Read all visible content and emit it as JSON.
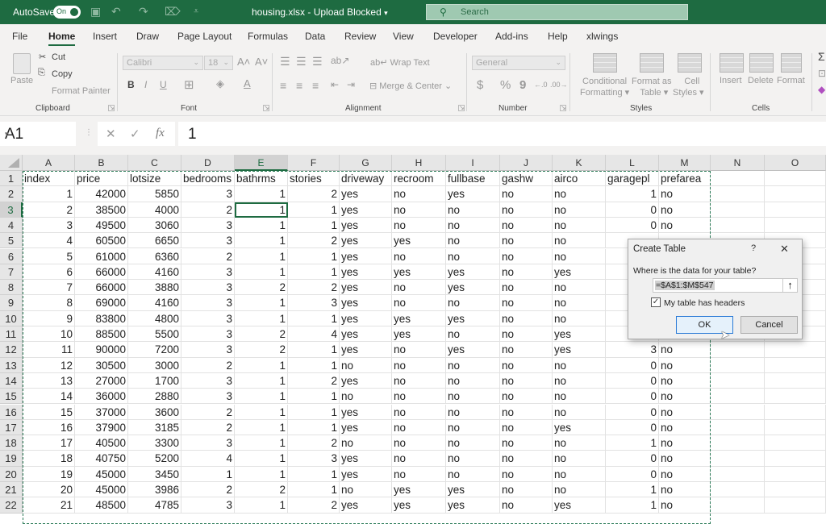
{
  "titlebar": {
    "autosave_label": "AutoSave",
    "autosave_state": "On",
    "document_title": "housing.xlsx  -  Upload Blocked",
    "title_dropdown": "▾",
    "search_placeholder": "Search",
    "qat_icons": [
      "save-icon",
      "undo-icon",
      "redo-icon",
      "format-icon",
      "customize-qat-icon"
    ]
  },
  "menu": {
    "tabs": [
      "File",
      "Home",
      "Insert",
      "Draw",
      "Page Layout",
      "Formulas",
      "Data",
      "Review",
      "View",
      "Developer",
      "Add-ins",
      "Help",
      "xlwings"
    ],
    "active": "Home"
  },
  "ribbon": {
    "clipboard": {
      "label": "Clipboard",
      "paste": "Paste",
      "cut": "Cut",
      "copy": "Copy",
      "format_painter": "Format Painter"
    },
    "font": {
      "label": "Font",
      "font_name": "Calibri",
      "font_size": "18",
      "bold": "B",
      "italic": "I",
      "underline": "U"
    },
    "alignment": {
      "label": "Alignment",
      "wrap_text": "Wrap Text",
      "merge_center": "Merge & Center"
    },
    "number": {
      "label": "Number",
      "format": "General",
      "currency": "$",
      "percent": "%",
      "comma": "9"
    },
    "styles": {
      "label": "Styles",
      "conditional": [
        "Conditional",
        "Formatting ▾"
      ],
      "format_table": [
        "Format as",
        "Table ▾"
      ],
      "cell_styles": [
        "Cell",
        "Styles ▾"
      ]
    },
    "cells": {
      "label": "Cells",
      "insert": "Insert",
      "delete": "Delete",
      "format": "Format"
    }
  },
  "formula_bar": {
    "name_box": "A1",
    "cancel": "✕",
    "enter": "✓",
    "fx": "fx",
    "value": "1"
  },
  "sheet": {
    "columns": [
      "A",
      "B",
      "C",
      "D",
      "E",
      "F",
      "G",
      "H",
      "I",
      "J",
      "K",
      "L",
      "M",
      "N",
      "O"
    ],
    "selected_column": "E",
    "selected_row": "3",
    "active_cell": "E3",
    "row_numbers": [
      "1",
      "2",
      "3",
      "4",
      "5",
      "6",
      "7",
      "8",
      "9",
      "10",
      "11",
      "12",
      "13",
      "14",
      "15",
      "16",
      "17",
      "18",
      "19",
      "20",
      "21",
      "22"
    ],
    "headers": [
      "index",
      "price",
      "lotsize",
      "bedrooms",
      "bathrms",
      "stories",
      "driveway",
      "recroom",
      "fullbase",
      "gashw",
      "airco",
      "garagepl",
      "prefarea"
    ],
    "rows": [
      [
        "1",
        "42000",
        "5850",
        "3",
        "1",
        "2",
        "yes",
        "no",
        "yes",
        "no",
        "no",
        "1",
        "no"
      ],
      [
        "2",
        "38500",
        "4000",
        "2",
        "1",
        "1",
        "yes",
        "no",
        "no",
        "no",
        "no",
        "0",
        "no"
      ],
      [
        "3",
        "49500",
        "3060",
        "3",
        "1",
        "1",
        "yes",
        "no",
        "no",
        "no",
        "no",
        "0",
        "no"
      ],
      [
        "4",
        "60500",
        "6650",
        "3",
        "1",
        "2",
        "yes",
        "yes",
        "no",
        "no",
        "no",
        "",
        ""
      ],
      [
        "5",
        "61000",
        "6360",
        "2",
        "1",
        "1",
        "yes",
        "no",
        "no",
        "no",
        "no",
        "",
        ""
      ],
      [
        "6",
        "66000",
        "4160",
        "3",
        "1",
        "1",
        "yes",
        "yes",
        "yes",
        "no",
        "yes",
        "",
        ""
      ],
      [
        "7",
        "66000",
        "3880",
        "3",
        "2",
        "2",
        "yes",
        "no",
        "yes",
        "no",
        "no",
        "",
        ""
      ],
      [
        "8",
        "69000",
        "4160",
        "3",
        "1",
        "3",
        "yes",
        "no",
        "no",
        "no",
        "no",
        "",
        ""
      ],
      [
        "9",
        "83800",
        "4800",
        "3",
        "1",
        "1",
        "yes",
        "yes",
        "yes",
        "no",
        "no",
        "",
        ""
      ],
      [
        "10",
        "88500",
        "5500",
        "3",
        "2",
        "4",
        "yes",
        "yes",
        "no",
        "no",
        "yes",
        "",
        ""
      ],
      [
        "11",
        "90000",
        "7200",
        "3",
        "2",
        "1",
        "yes",
        "no",
        "yes",
        "no",
        "yes",
        "3",
        "no"
      ],
      [
        "12",
        "30500",
        "3000",
        "2",
        "1",
        "1",
        "no",
        "no",
        "no",
        "no",
        "no",
        "0",
        "no"
      ],
      [
        "13",
        "27000",
        "1700",
        "3",
        "1",
        "2",
        "yes",
        "no",
        "no",
        "no",
        "no",
        "0",
        "no"
      ],
      [
        "14",
        "36000",
        "2880",
        "3",
        "1",
        "1",
        "no",
        "no",
        "no",
        "no",
        "no",
        "0",
        "no"
      ],
      [
        "15",
        "37000",
        "3600",
        "2",
        "1",
        "1",
        "yes",
        "no",
        "no",
        "no",
        "no",
        "0",
        "no"
      ],
      [
        "16",
        "37900",
        "3185",
        "2",
        "1",
        "1",
        "yes",
        "no",
        "no",
        "no",
        "yes",
        "0",
        "no"
      ],
      [
        "17",
        "40500",
        "3300",
        "3",
        "1",
        "2",
        "no",
        "no",
        "no",
        "no",
        "no",
        "1",
        "no"
      ],
      [
        "18",
        "40750",
        "5200",
        "4",
        "1",
        "3",
        "yes",
        "no",
        "no",
        "no",
        "no",
        "0",
        "no"
      ],
      [
        "19",
        "45000",
        "3450",
        "1",
        "1",
        "1",
        "yes",
        "no",
        "no",
        "no",
        "no",
        "0",
        "no"
      ],
      [
        "20",
        "45000",
        "3986",
        "2",
        "2",
        "1",
        "no",
        "yes",
        "yes",
        "no",
        "no",
        "1",
        "no"
      ],
      [
        "21",
        "48500",
        "4785",
        "3",
        "1",
        "2",
        "yes",
        "yes",
        "yes",
        "no",
        "yes",
        "1",
        "no"
      ]
    ]
  },
  "dialog": {
    "title": "Create Table",
    "help": "?",
    "close": "✕",
    "prompt": "Where is the data for your table?",
    "range": "=$A$1:$M$547",
    "collapse": "🠕",
    "has_headers_label": "My table has headers",
    "has_headers_checked": true,
    "check_mark": "✓",
    "ok": "OK",
    "cancel": "Cancel"
  },
  "colors": {
    "brand": "#1e6b41",
    "ribbon_bg": "#f3f2f1",
    "selection": "#1e6b41",
    "ok_border": "#2a7ad6"
  }
}
